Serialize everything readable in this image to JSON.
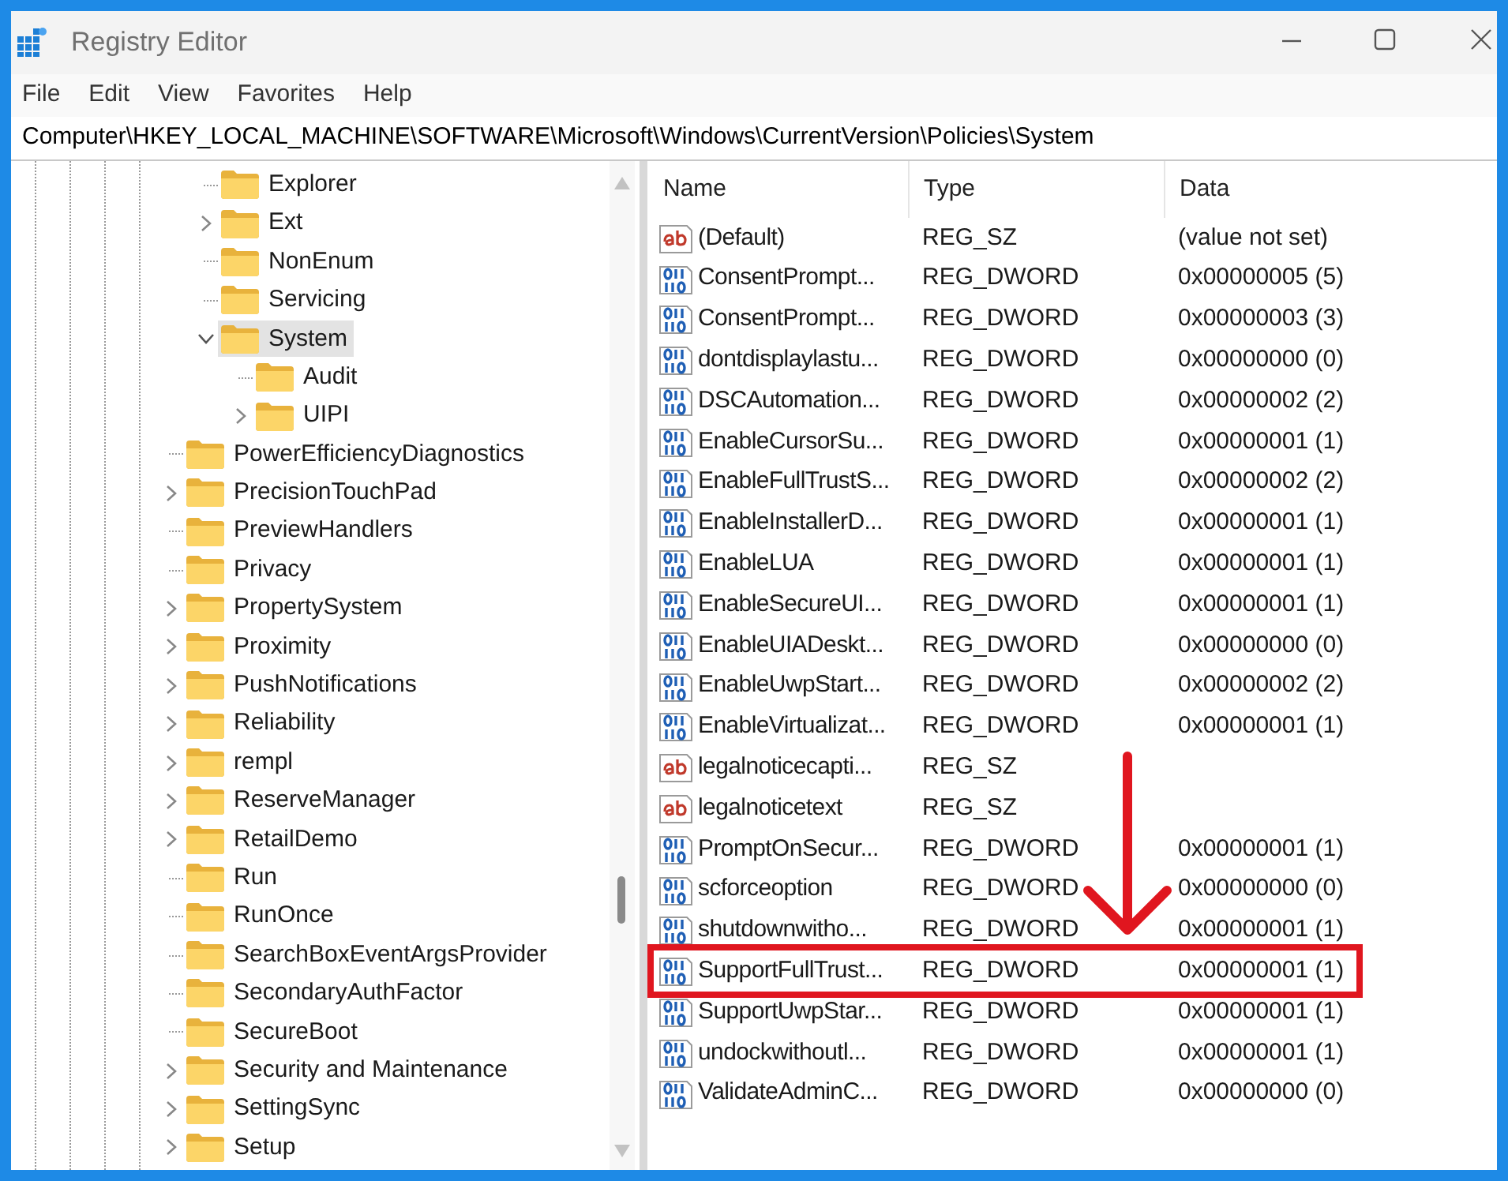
{
  "window": {
    "title": "Registry Editor"
  },
  "menu": [
    "File",
    "Edit",
    "View",
    "Favorites",
    "Help"
  ],
  "address": "Computer\\HKEY_LOCAL_MACHINE\\SOFTWARE\\Microsoft\\Windows\\CurrentVersion\\Policies\\System",
  "tree": {
    "items": [
      {
        "children": [
          {
            "label": "Explorer",
            "expandable": false,
            "selected": false
          },
          {
            "label": "Ext",
            "expandable": true,
            "expanded": false,
            "selected": false
          },
          {
            "label": "NonEnum",
            "expandable": false,
            "selected": false
          },
          {
            "label": "Servicing",
            "expandable": false,
            "selected": false
          },
          {
            "label": "System",
            "expandable": true,
            "expanded": true,
            "selected": true,
            "children": [
              {
                "label": "Audit",
                "expandable": false,
                "selected": false
              },
              {
                "label": "UIPI",
                "expandable": true,
                "expanded": false,
                "selected": false
              }
            ]
          }
        ]
      },
      {
        "label": "PowerEfficiencyDiagnostics",
        "expandable": false,
        "selected": false
      },
      {
        "label": "PrecisionTouchPad",
        "expandable": true,
        "expanded": false,
        "selected": false
      },
      {
        "label": "PreviewHandlers",
        "expandable": false,
        "selected": false
      },
      {
        "label": "Privacy",
        "expandable": false,
        "selected": false
      },
      {
        "label": "PropertySystem",
        "expandable": true,
        "expanded": false,
        "selected": false
      },
      {
        "label": "Proximity",
        "expandable": true,
        "expanded": false,
        "selected": false
      },
      {
        "label": "PushNotifications",
        "expandable": true,
        "expanded": false,
        "selected": false
      },
      {
        "label": "Reliability",
        "expandable": true,
        "expanded": false,
        "selected": false
      },
      {
        "label": "rempl",
        "expandable": true,
        "expanded": false,
        "selected": false
      },
      {
        "label": "ReserveManager",
        "expandable": true,
        "expanded": false,
        "selected": false
      },
      {
        "label": "RetailDemo",
        "expandable": true,
        "expanded": false,
        "selected": false
      },
      {
        "label": "Run",
        "expandable": false,
        "selected": false
      },
      {
        "label": "RunOnce",
        "expandable": false,
        "selected": false
      },
      {
        "label": "SearchBoxEventArgsProvider",
        "expandable": false,
        "selected": false
      },
      {
        "label": "SecondaryAuthFactor",
        "expandable": false,
        "selected": false
      },
      {
        "label": "SecureBoot",
        "expandable": false,
        "selected": false
      },
      {
        "label": "Security and Maintenance",
        "expandable": true,
        "expanded": false,
        "selected": false
      },
      {
        "label": "SettingSync",
        "expandable": true,
        "expanded": false,
        "selected": false
      },
      {
        "label": "Setup",
        "expandable": true,
        "expanded": false,
        "selected": false
      }
    ]
  },
  "values": {
    "columns": [
      "Name",
      "Type",
      "Data"
    ],
    "rows": [
      {
        "kind": "string",
        "name": "(Default)",
        "type": "REG_SZ",
        "data": "(value not set)",
        "highlighted": false
      },
      {
        "kind": "dword",
        "name": "ConsentPrompt...",
        "type": "REG_DWORD",
        "data": "0x00000005 (5)",
        "highlighted": false
      },
      {
        "kind": "dword",
        "name": "ConsentPrompt...",
        "type": "REG_DWORD",
        "data": "0x00000003 (3)",
        "highlighted": false
      },
      {
        "kind": "dword",
        "name": "dontdisplaylastu...",
        "type": "REG_DWORD",
        "data": "0x00000000 (0)",
        "highlighted": false
      },
      {
        "kind": "dword",
        "name": "DSCAutomation...",
        "type": "REG_DWORD",
        "data": "0x00000002 (2)",
        "highlighted": false
      },
      {
        "kind": "dword",
        "name": "EnableCursorSu...",
        "type": "REG_DWORD",
        "data": "0x00000001 (1)",
        "highlighted": false
      },
      {
        "kind": "dword",
        "name": "EnableFullTrustS...",
        "type": "REG_DWORD",
        "data": "0x00000002 (2)",
        "highlighted": false
      },
      {
        "kind": "dword",
        "name": "EnableInstallerD...",
        "type": "REG_DWORD",
        "data": "0x00000001 (1)",
        "highlighted": false
      },
      {
        "kind": "dword",
        "name": "EnableLUA",
        "type": "REG_DWORD",
        "data": "0x00000001 (1)",
        "highlighted": false
      },
      {
        "kind": "dword",
        "name": "EnableSecureUI...",
        "type": "REG_DWORD",
        "data": "0x00000001 (1)",
        "highlighted": false
      },
      {
        "kind": "dword",
        "name": "EnableUIADeskt...",
        "type": "REG_DWORD",
        "data": "0x00000000 (0)",
        "highlighted": false
      },
      {
        "kind": "dword",
        "name": "EnableUwpStart...",
        "type": "REG_DWORD",
        "data": "0x00000002 (2)",
        "highlighted": false
      },
      {
        "kind": "dword",
        "name": "EnableVirtualizat...",
        "type": "REG_DWORD",
        "data": "0x00000001 (1)",
        "highlighted": false
      },
      {
        "kind": "string",
        "name": "legalnoticecapti...",
        "type": "REG_SZ",
        "highlighted": false
      },
      {
        "kind": "string",
        "name": "legalnoticetext",
        "type": "REG_SZ",
        "highlighted": false
      },
      {
        "kind": "dword",
        "name": "PromptOnSecur...",
        "type": "REG_DWORD",
        "data": "0x00000001 (1)",
        "highlighted": false
      },
      {
        "kind": "dword",
        "name": "scforceoption",
        "type": "REG_DWORD",
        "data": "0x00000000 (0)",
        "highlighted": false
      },
      {
        "kind": "dword",
        "name": "shutdownwitho...",
        "type": "REG_DWORD",
        "data": "0x00000001 (1)",
        "highlighted": false
      },
      {
        "kind": "dword",
        "name": "SupportFullTrust...",
        "type": "REG_DWORD",
        "data": "0x00000001 (1)",
        "highlighted": true
      },
      {
        "kind": "dword",
        "name": "SupportUwpStar...",
        "type": "REG_DWORD",
        "data": "0x00000001 (1)",
        "highlighted": false
      },
      {
        "kind": "dword",
        "name": "undockwithoutl...",
        "type": "REG_DWORD",
        "data": "0x00000001 (1)",
        "highlighted": false
      },
      {
        "kind": "dword",
        "name": "ValidateAdminC...",
        "type": "REG_DWORD",
        "data": "0x00000000 (0)",
        "highlighted": false
      }
    ]
  }
}
